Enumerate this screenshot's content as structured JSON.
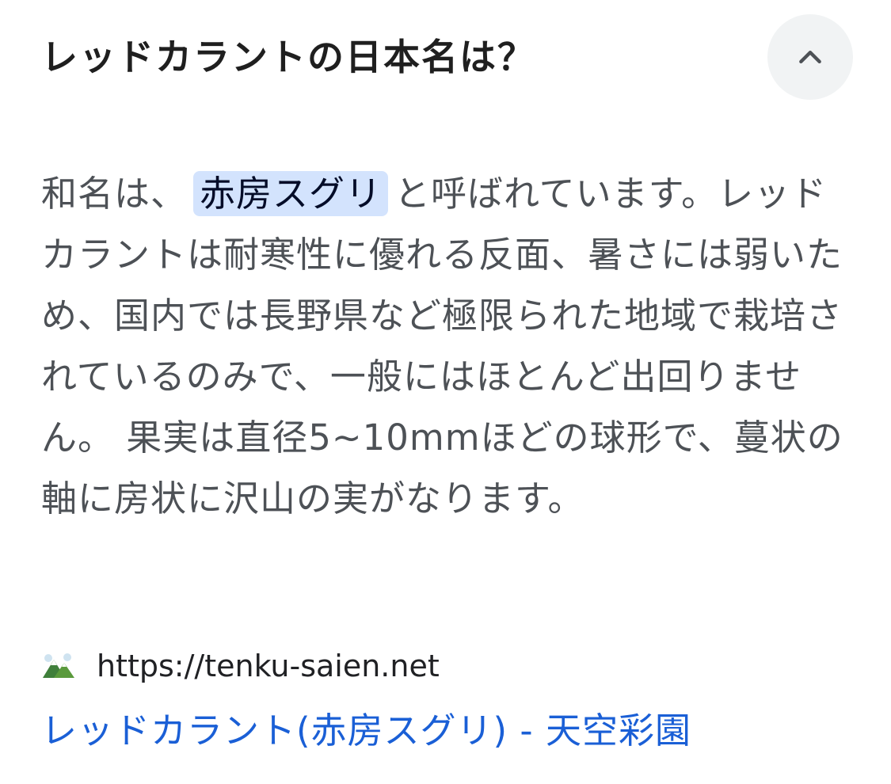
{
  "question": {
    "title": "レッドカラントの日本名は？"
  },
  "collapse_button": {
    "icon": "chevron-up-icon"
  },
  "answer": {
    "before_highlight": "和名は、",
    "highlight": "赤房スグリ",
    "after_highlight": "と呼ばれています。レッドカラントは耐寒性に優れる反面、暑さには弱いため、国内では長野県など極限られた地域で栽培されているのみで、一般にはほとんど出回りません。 果実は直径5~10mmほどの球形で、蔓状の軸に房状に沢山の実がなります。"
  },
  "source": {
    "favicon": "mountain-icon",
    "url": "https://tenku-saien.net"
  },
  "result": {
    "link_text": "レッドカラント(赤房スグリ) - 天空彩園"
  },
  "colors": {
    "highlight_bg": "#d3e3fd",
    "link": "#1a5fd6",
    "body_text": "#4d5156"
  }
}
